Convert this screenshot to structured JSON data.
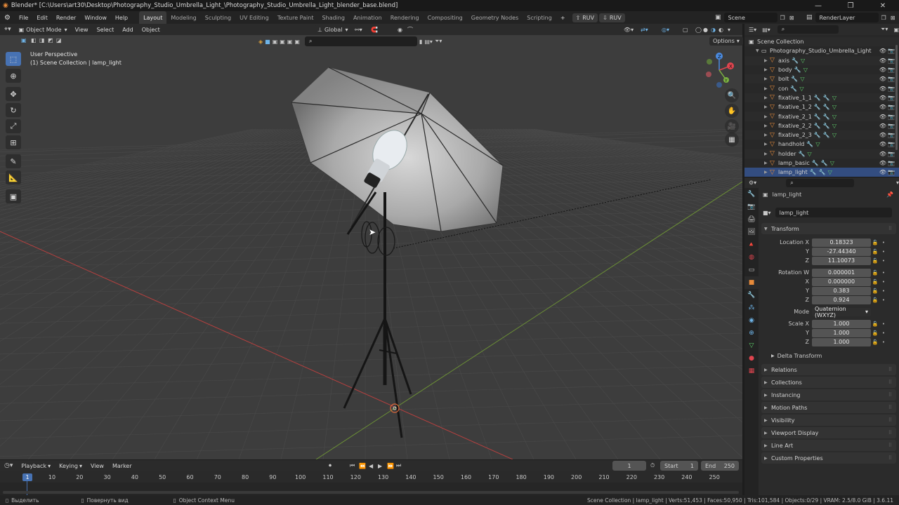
{
  "window": {
    "title": "Blender* [C:\\Users\\art30\\Desktop\\Photography_Studio_Umbrella_Light_\\Photography_Studio_Umbrella_Light_blender_base.blend]",
    "controls": [
      "—",
      "❐",
      "✕"
    ]
  },
  "menubar": {
    "menus": [
      "File",
      "Edit",
      "Render",
      "Window",
      "Help"
    ],
    "workspaces": [
      "Layout",
      "Modeling",
      "Sculpting",
      "UV Editing",
      "Texture Paint",
      "Shading",
      "Animation",
      "Rendering",
      "Compositing",
      "Geometry Nodes",
      "Scripting"
    ],
    "active_workspace": "Layout",
    "add_tab": "+",
    "ruv1": "RUV",
    "ruv2": "RUV",
    "scene": "Scene",
    "view_layer": "RenderLayer"
  },
  "viewport": {
    "mode": "Object Mode",
    "menus": [
      "View",
      "Select",
      "Add",
      "Object"
    ],
    "transform_orientation": "Global",
    "options": "Options",
    "overlay_title": "User Perspective",
    "overlay_subtitle": "(1) Scene Collection | lamp_light",
    "gizmo": {
      "x": "X",
      "y": "Y",
      "z": "Z"
    }
  },
  "outliner": {
    "root": "Scene Collection",
    "collection": "Photography_Studio_Umbrella_Light",
    "objects": [
      {
        "name": "axis",
        "mods": 1
      },
      {
        "name": "body",
        "mods": 1
      },
      {
        "name": "bolt",
        "mods": 1
      },
      {
        "name": "con",
        "mods": 1
      },
      {
        "name": "fixative_1_1",
        "mods": 2
      },
      {
        "name": "fixative_1_2",
        "mods": 2
      },
      {
        "name": "fixative_2_1",
        "mods": 2
      },
      {
        "name": "fixative_2_2",
        "mods": 2
      },
      {
        "name": "fixative_2_3",
        "mods": 2
      },
      {
        "name": "handhold",
        "mods": 1
      },
      {
        "name": "holder",
        "mods": 1
      },
      {
        "name": "lamp_basic",
        "mods": 2
      },
      {
        "name": "lamp_light",
        "mods": 2
      }
    ]
  },
  "properties": {
    "object_name": "lamp_light",
    "data_name": "lamp_light",
    "transform_label": "Transform",
    "location": {
      "label": "Location X",
      "x": "0.18323",
      "y": "-27.44340",
      "z": "11.10073"
    },
    "rotation": {
      "label": "Rotation W",
      "w": "0.000001",
      "x": "0.000000",
      "y": "0.383",
      "z": "0.924"
    },
    "axis_labels": {
      "x": "X",
      "y": "Y",
      "z": "Z"
    },
    "mode_label": "Mode",
    "mode_value": "Quaternion (WXYZ)",
    "scale": {
      "label": "Scale X",
      "x": "1.000",
      "y": "1.000",
      "z": "1.000"
    },
    "delta_transform": "Delta Transform",
    "panels": [
      "Relations",
      "Collections",
      "Instancing",
      "Motion Paths",
      "Visibility",
      "Viewport Display",
      "Line Art",
      "Custom Properties"
    ]
  },
  "timeline": {
    "menus": [
      "Playback",
      "Keying",
      "View",
      "Marker"
    ],
    "current_frame": "1",
    "start_label": "Start",
    "start": "1",
    "end_label": "End",
    "end": "250",
    "ticks": [
      "10",
      "20",
      "30",
      "40",
      "50",
      "60",
      "70",
      "80",
      "90",
      "100",
      "110",
      "120",
      "130",
      "140",
      "150",
      "160",
      "170",
      "180",
      "190",
      "200",
      "210",
      "220",
      "230",
      "240",
      "250"
    ],
    "playhead": "1"
  },
  "statusbar": {
    "select": "Выделить",
    "rotate": "Повернуть вид",
    "context": "Object Context Menu",
    "stats": "Scene Collection | lamp_light | Verts:51,453 | Faces:50,950 | Tris:101,584 | Objects:0/29 | VRAM: 2.5/8.0 GiB | 3.6.11"
  },
  "colors": {
    "accent": "#4772b3",
    "object": "#e88b3a",
    "x_axis": "#e0454f",
    "y_axis": "#7cb342",
    "z_axis": "#4b8be0"
  }
}
